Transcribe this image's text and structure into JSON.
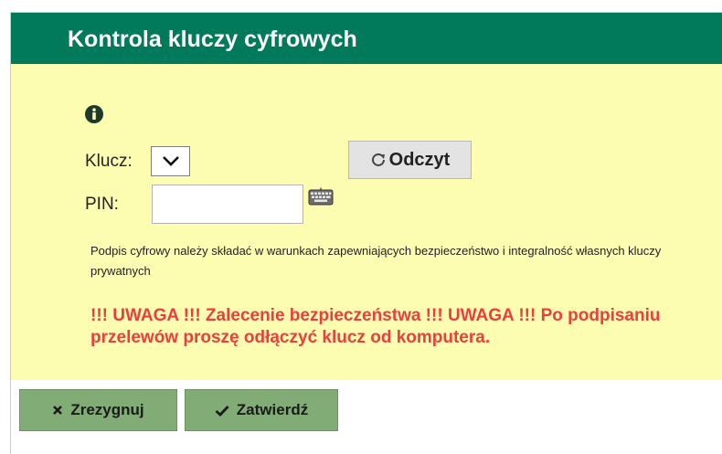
{
  "header": {
    "title": "Kontrola kluczy cyfrowych"
  },
  "form": {
    "key_label": "Klucz:",
    "key_value": "",
    "read_button": "Odczyt",
    "pin_label": "PIN:",
    "pin_value": ""
  },
  "note": "Podpis cyfrowy należy składać w warunkach zapewniających bezpieczeństwo i integralność własnych kluczy prywatnych",
  "warning": "!!! UWAGA !!! Zalecenie bezpieczeństwa !!! UWAGA !!! Po podpisaniu przelewów proszę odłączyć klucz od komputera.",
  "buttons": {
    "cancel": "Zrezygnuj",
    "confirm": "Zatwierdź"
  },
  "icons": {
    "info": "info-circle-icon",
    "dropdown": "chevron-down-icon",
    "refresh": "refresh-icon",
    "keyboard": "keyboard-icon",
    "cancel": "close-icon",
    "confirm": "check-icon"
  },
  "colors": {
    "header_bg": "#007a5a",
    "panel_bg": "#fdfdb1",
    "warning_text": "#ec3e3e",
    "button_bg": "#82ac76"
  }
}
